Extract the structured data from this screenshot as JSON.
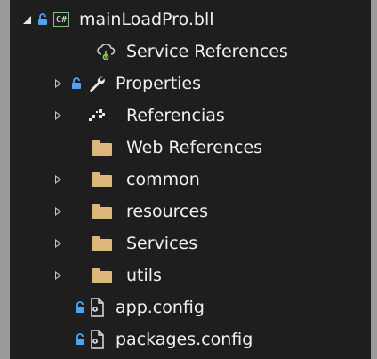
{
  "tree": {
    "project": {
      "label": "mainLoadPro.bll",
      "badge": "C#"
    },
    "items": [
      {
        "label": "Service References"
      },
      {
        "label": "Properties"
      },
      {
        "label": "Referencias"
      },
      {
        "label": "Web References"
      },
      {
        "label": "common"
      },
      {
        "label": "resources"
      },
      {
        "label": "Services"
      },
      {
        "label": "utils"
      },
      {
        "label": "app.config"
      },
      {
        "label": "packages.config"
      }
    ]
  },
  "colors": {
    "background": "#1e1e1e",
    "text": "#f1f1f1",
    "folder": "#dcb67a",
    "lock": "#4fa3f7",
    "csharp": "#7ec27e"
  }
}
